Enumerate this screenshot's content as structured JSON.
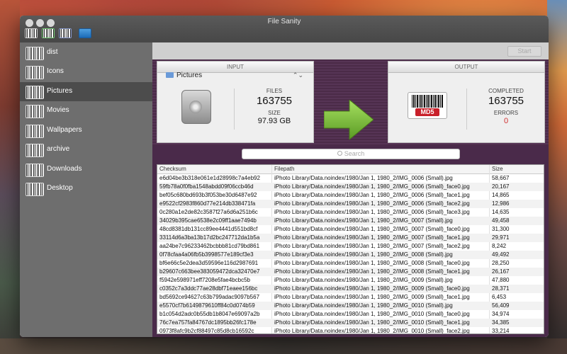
{
  "window": {
    "title": "File Sanity"
  },
  "toolbar": {
    "icons": [
      "barcode-md5-icon",
      "barcode-sha1-icon",
      "barcode-sha256-icon",
      "folder-blue-icon"
    ]
  },
  "sidebar": {
    "items": [
      {
        "label": "dist",
        "selected": false
      },
      {
        "label": "Icons",
        "selected": false
      },
      {
        "label": "Pictures",
        "selected": true
      },
      {
        "label": "Movies",
        "selected": false
      },
      {
        "label": "Wallpapers",
        "selected": false
      },
      {
        "label": "archive",
        "selected": false
      },
      {
        "label": "Downloads",
        "selected": false
      },
      {
        "label": "Desktop",
        "selected": false
      }
    ]
  },
  "actions": {
    "start_label": "Start"
  },
  "input": {
    "header": "INPUT",
    "folder": "Pictures",
    "files_label": "FILES",
    "files_value": "163755",
    "size_label": "SIZE",
    "size_value": "97.93 GB"
  },
  "output": {
    "header": "OUTPUT",
    "completed_label": "COMPLETED",
    "completed_value": "163755",
    "errors_label": "ERRORS",
    "errors_value": "0",
    "errors_color": "#d03030",
    "badge_text": "MD5"
  },
  "search": {
    "placeholder": "Search"
  },
  "table": {
    "columns": [
      "Checksum",
      "Filepath",
      "Size"
    ],
    "rows": [
      [
        "e6d04be3b318e061e1d28998c7a4eb92",
        "iPhoto Library/Data.noindex/1980/Jan 1, 1980_2/IMG_0006 (Small).jpg",
        "58,667"
      ],
      [
        "59fb78a0f0fba1548abdd09f06ccb46d",
        "iPhoto Library/Data.noindex/1980/Jan 1, 1980_2/IMG_0006 (Small)_face0.jpg",
        "20,167"
      ],
      [
        "bef05c680bd693b3f053be30d6487e92",
        "iPhoto Library/Data.noindex/1980/Jan 1, 1980_2/IMG_0006 (Small)_face1.jpg",
        "14,865"
      ],
      [
        "e9522cf2983f860d77e214db338471fa",
        "iPhoto Library/Data.noindex/1980/Jan 1, 1980_2/IMG_0006 (Small)_face2.jpg",
        "12,986"
      ],
      [
        "0c280a1e2de82c3587f27a6d6a251b6c",
        "iPhoto Library/Data.noindex/1980/Jan 1, 1980_2/IMG_0006 (Small)_face3.jpg",
        "14,635"
      ],
      [
        "34029b395cae6538e2c09ff1aae7494b",
        "iPhoto Library/Data.noindex/1980/Jan 1, 1980_2/IMG_0007 (Small).jpg",
        "49,458"
      ],
      [
        "48cd8381db131cc89ee4441d551bd8cf",
        "iPhoto Library/Data.noindex/1980/Jan 1, 1980_2/IMG_0007 (Small)_face0.jpg",
        "31,300"
      ],
      [
        "33114d6a3ba13b17d2bc247712da1b5a",
        "iPhoto Library/Data.noindex/1980/Jan 1, 1980_2/IMG_0007 (Small)_face1.jpg",
        "29,971"
      ],
      [
        "aa24be7c96233462bcbbb81cd79bd861",
        "iPhoto Library/Data.noindex/1980/Jan 1, 1980_2/IMG_0007 (Small)_face2.jpg",
        "8,242"
      ],
      [
        "0f78cfaa4a06fb5b3998577e189cf3e3",
        "iPhoto Library/Data.noindex/1980/Jan 1, 1980_2/IMG_0008 (Small).jpg",
        "49,492"
      ],
      [
        "bf6e66c5e2dea3d59596e116d2987691",
        "iPhoto Library/Data.noindex/1980/Jan 1, 1980_2/IMG_0008 (Small)_face0.jpg",
        "28,250"
      ],
      [
        "b29607c663bee383059472dca32470e7",
        "iPhoto Library/Data.noindex/1980/Jan 1, 1980_2/IMG_0008 (Small)_face1.jpg",
        "26,167"
      ],
      [
        "f5942e598971eff7208e5fae4bcbc5b",
        "iPhoto Library/Data.noindex/1980/Jan 1, 1980_2/IMG_0009 (Small).jpg",
        "47,880"
      ],
      [
        "c0352c7a3ddc77ae28dbf71eaee156bc",
        "iPhoto Library/Data.noindex/1980/Jan 1, 1980_2/IMG_0009 (Small)_face0.jpg",
        "28,371"
      ],
      [
        "bd5692ce94627c63b799adac9097b567",
        "iPhoto Library/Data.noindex/1980/Jan 1, 1980_2/IMG_0009 (Small)_face1.jpg",
        "6,453"
      ],
      [
        "e5570cf7b6149879610ff84c0d074b59",
        "iPhoto Library/Data.noindex/1980/Jan 1, 1980_2/IMG_0010 (Small).jpg",
        "56,409"
      ],
      [
        "b1c054d2adc0b55db1b8047e69097a2b",
        "iPhoto Library/Data.noindex/1980/Jan 1, 1980_2/IMG_0010 (Small)_face0.jpg",
        "34,974"
      ],
      [
        "76c7ea757fa84767dc1895bb26fc178e",
        "iPhoto Library/Data.noindex/1980/Jan 1, 1980_2/IMG_0010 (Small)_face1.jpg",
        "34,385"
      ],
      [
        "0973f8afc9b2cf88497c85d8cb16592c",
        "iPhoto Library/Data.noindex/1980/Jan 1, 1980_2/IMG_0010 (Small)_face2.jpg",
        "33,214"
      ]
    ]
  },
  "colors": {
    "accent_green": "#7fc23a",
    "panel_bg": "#4a2a4a",
    "badge_red": "#c9202a"
  }
}
